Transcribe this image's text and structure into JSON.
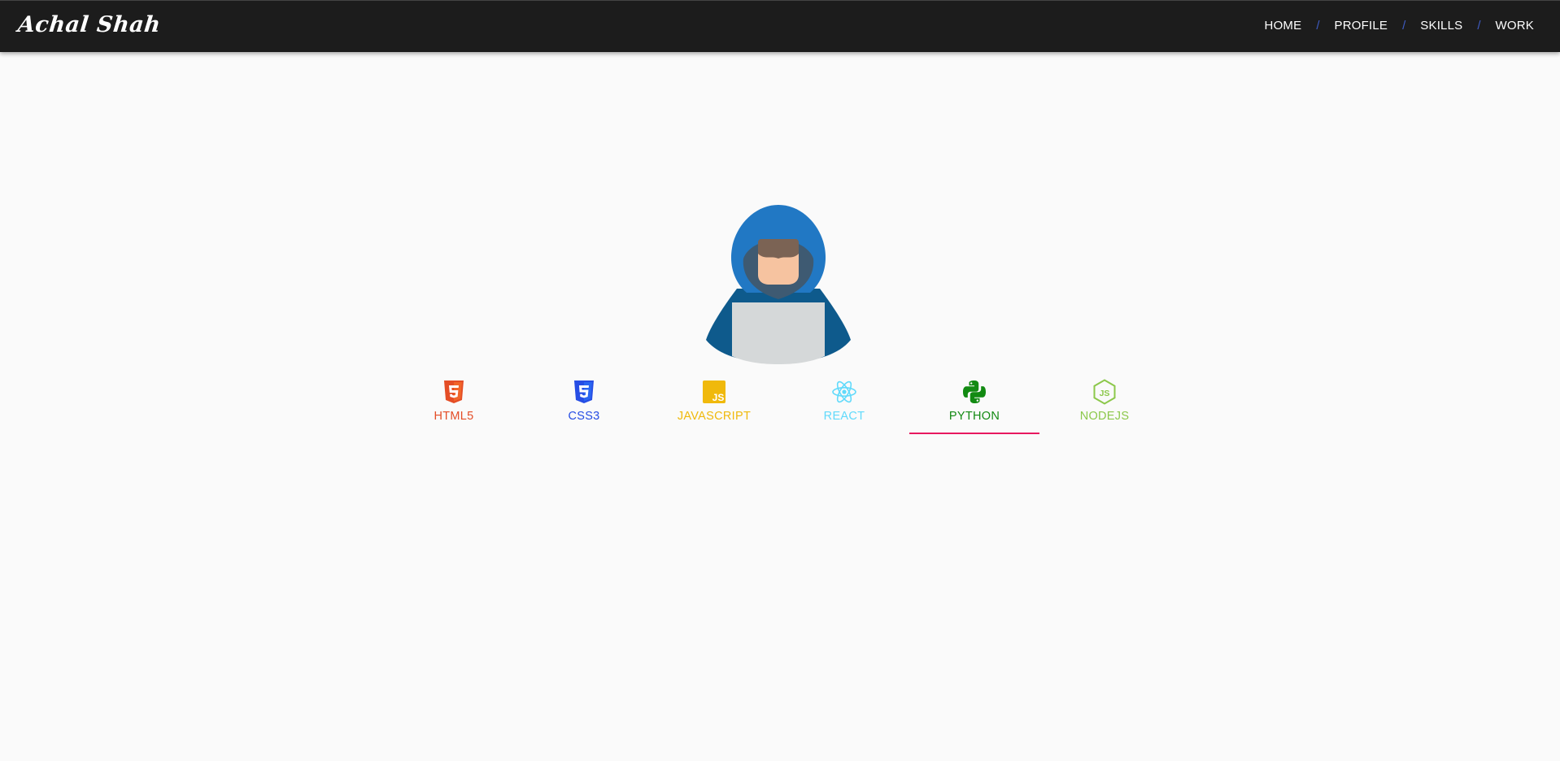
{
  "brand": {
    "name": "Achal Shah"
  },
  "nav": {
    "items": [
      {
        "label": "HOME"
      },
      {
        "label": "PROFILE"
      },
      {
        "label": "SKILLS"
      },
      {
        "label": "WORK"
      }
    ],
    "separator": "/"
  },
  "avatar": {
    "icon": "hooded-developer-laptop-icon"
  },
  "skills": {
    "active_index": 4,
    "tabs": [
      {
        "label": "HTML5",
        "icon": "html5-icon",
        "color": "#e44d26"
      },
      {
        "label": "CSS3",
        "icon": "css3-icon",
        "color": "#264de4"
      },
      {
        "label": "JAVASCRIPT",
        "icon": "javascript-icon",
        "color": "#f0c419"
      },
      {
        "label": "REACT",
        "icon": "react-icon",
        "color": "#61dafb"
      },
      {
        "label": "PYTHON",
        "icon": "python-icon",
        "color": "#128a12"
      },
      {
        "label": "NODEJS",
        "icon": "nodejs-icon",
        "color": "#8cc84b"
      }
    ],
    "indicator_color": "#e8185f"
  }
}
